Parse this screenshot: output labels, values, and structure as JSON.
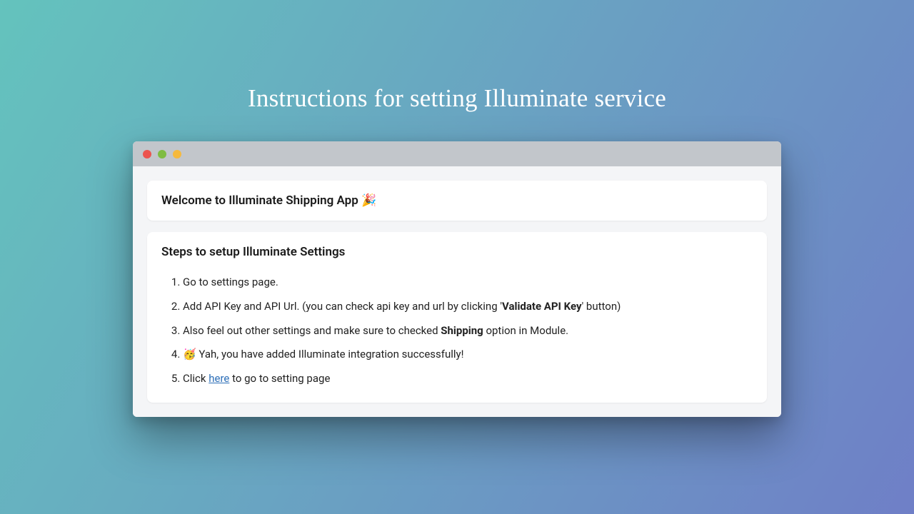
{
  "page": {
    "title": "Instructions for setting Illuminate service"
  },
  "welcome": {
    "heading": "Welcome to Illuminate Shipping App 🎉"
  },
  "steps": {
    "heading": "Steps to setup Illuminate Settings",
    "items": {
      "s1": "Go to settings page.",
      "s2_pre": "Add API Key and API Url. (you can check api key and url by clicking '",
      "s2_bold": "Validate API Key",
      "s2_post": "' button)",
      "s3_pre": "Also feel out other settings and make sure to checked ",
      "s3_bold": "Shipping",
      "s3_post": " option in Module.",
      "s4": "🥳 Yah, you have added Illuminate integration successfully!",
      "s5_pre": "Click ",
      "s5_link": "here",
      "s5_post": " to go to setting page"
    }
  }
}
